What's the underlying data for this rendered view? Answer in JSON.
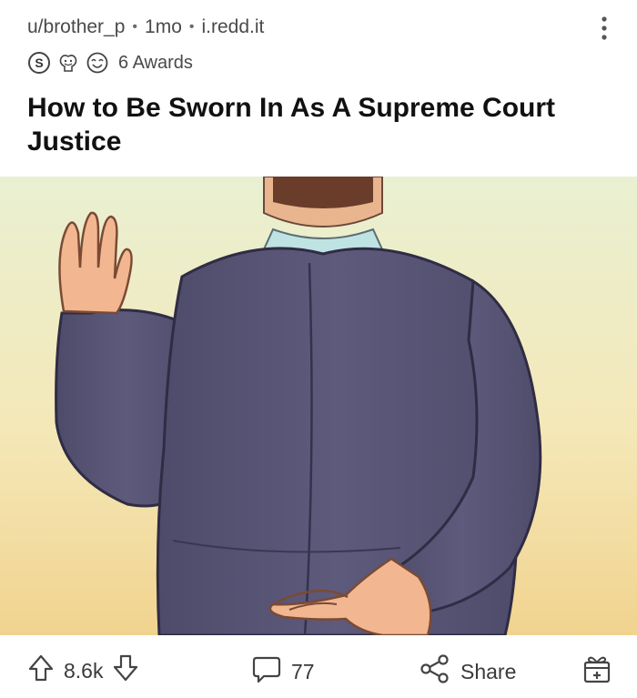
{
  "post": {
    "author": "u/brother_p",
    "age": "1mo",
    "domain": "i.redd.it",
    "awards_label": "6 Awards",
    "title": "How to Be Sworn In As A Supreme Court Justice"
  },
  "image": {
    "subject": "wikiHow-style illustration: man in purple suit raising right hand while crossing fingers behind his back"
  },
  "actions": {
    "score": "8.6k",
    "comments": "77",
    "share_label": "Share"
  },
  "icons": [
    "more-icon",
    "silver-award-icon",
    "wholesome-award-icon",
    "face-award-icon",
    "upvote-icon",
    "downvote-icon",
    "comment-icon",
    "share-icon",
    "gift-award-icon"
  ],
  "colors": {
    "suit": "#5a5775",
    "background_top": "#e8efcf",
    "background_bottom": "#f2d79a"
  }
}
